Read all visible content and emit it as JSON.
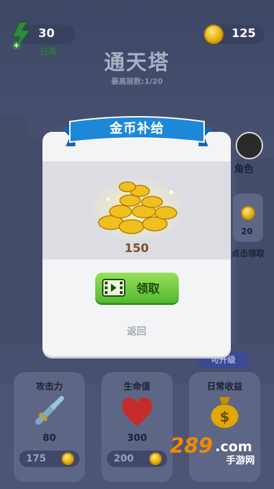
{
  "status": {
    "energy": "30",
    "energy_note": "已满",
    "coins": "125"
  },
  "header": {
    "title": "通天塔",
    "subtitle": "最高层数:1/20"
  },
  "side": {
    "character_label": "角色",
    "chest_value": "20",
    "chest_label": "点击领取"
  },
  "upgrade_badge": "可升级",
  "cards": [
    {
      "label": "攻击力",
      "value": "80",
      "cost": "175"
    },
    {
      "label": "生命值",
      "value": "300",
      "cost": "200"
    },
    {
      "label": "日常收益",
      "value": "",
      "cost": ""
    }
  ],
  "modal": {
    "title": "金币补给",
    "amount": "150",
    "claim_label": "领取",
    "back_label": "返回"
  },
  "watermark": {
    "number": "289",
    "suffix": ".com",
    "text": "手游网"
  },
  "colors": {
    "ribbon": "#1e88d8",
    "claim_button": "#6cc83b",
    "background": "#4a5373"
  }
}
